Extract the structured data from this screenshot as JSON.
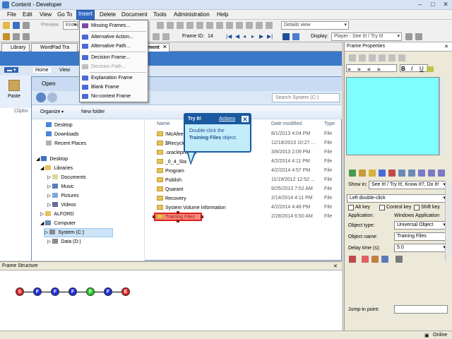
{
  "window": {
    "title": "Content - Developer"
  },
  "menu": [
    "File",
    "Edit",
    "View",
    "Go To",
    "Insert",
    "Delete",
    "Document",
    "Tools",
    "Administration",
    "Help"
  ],
  "toolbar": {
    "preview_label": "Preview",
    "know_combo": "Know",
    "view_combo": "Details view",
    "frame_id_label": "Frame ID:",
    "frame_id_value": "14",
    "display_label": "Display:",
    "display_combo": "Player - See It! / Try It!"
  },
  "doc_tabs": [
    {
      "label": "Library"
    },
    {
      "label": "WordPad Tra"
    },
    {
      "label": "ment"
    }
  ],
  "insert_menu": {
    "items": [
      {
        "label": "Missing Frames...",
        "disabled": false,
        "color": "#7a4aa8"
      },
      {
        "label": "Alternative Action...",
        "disabled": false,
        "color": "#4a6ad8"
      },
      {
        "label": "Alternative Path...",
        "disabled": false,
        "color": "#4a6ad8"
      },
      {
        "label": "Decision Frame...",
        "disabled": false,
        "color": "#4a6ad8"
      },
      {
        "label": "Decision Path...",
        "disabled": true,
        "color": "#a0a0a0"
      },
      {
        "label": "Explanation Frame",
        "disabled": false,
        "color": "#4a6ad8"
      },
      {
        "label": "Blank Frame",
        "disabled": false,
        "color": "#4a6ad8"
      },
      {
        "label": "No-context Frame",
        "disabled": false,
        "color": "#4a6ad8"
      }
    ]
  },
  "ribbon": {
    "tabs": [
      "Home",
      "View"
    ],
    "paste_label": "Paste",
    "clipboard_label": "Clipbo"
  },
  "explorer": {
    "title": "Open",
    "search_placeholder": "Search System (C:)",
    "organize_label": "Organize",
    "new_folder_label": "New folder",
    "nav": [
      {
        "label": "Desktop",
        "indent": 0
      },
      {
        "label": "Downloads",
        "indent": 0
      },
      {
        "label": "Recent Places",
        "indent": 0
      },
      {
        "label": "Desktop",
        "indent": 1
      },
      {
        "label": "Libraries",
        "indent": 2
      },
      {
        "label": "Documents",
        "indent": 3
      },
      {
        "label": "Music",
        "indent": 3
      },
      {
        "label": "Pictures",
        "indent": 3
      },
      {
        "label": "Videos",
        "indent": 3
      },
      {
        "label": "ALFORD",
        "indent": 2
      },
      {
        "label": "Computer",
        "indent": 2
      },
      {
        "label": "System (C:)",
        "indent": 3,
        "selected": true
      },
      {
        "label": "Data (D:)",
        "indent": 3
      }
    ],
    "columns": {
      "name": "Name",
      "date": "Date modified",
      "type": "Type"
    },
    "files": [
      {
        "name": "!McAfee.log",
        "date": "8/1/2013 4:04 PM",
        "type": "File"
      },
      {
        "name": "$Recycle.Bin",
        "date": "12/18/2013 10:27 ...",
        "type": "File"
      },
      {
        "name": ".oracleprinters",
        "date": "3/8/2013 2:09 PM",
        "type": "File"
      },
      {
        "name": "_0_4_Sta",
        "date": "4/2/2014 4:11 PM",
        "type": "File"
      },
      {
        "name": "Program",
        "date": "4/2/2014 4:57 PM",
        "type": "File"
      },
      {
        "name": "Publish",
        "date": "11/19/2012 12:52 ...",
        "type": "File"
      },
      {
        "name": "Quarant",
        "date": "9/25/2013 7:52 AM",
        "type": "File"
      },
      {
        "name": "Recovery",
        "date": "2/14/2014 4:11 PM",
        "type": "File"
      },
      {
        "name": "System Volume Information",
        "date": "4/2/2014 4:48 PM",
        "type": "File"
      },
      {
        "name": "Training Files",
        "date": "2/28/2014 6:50 AM",
        "type": "File"
      }
    ]
  },
  "bubble": {
    "title": "Try It!",
    "actions": "Actions",
    "text_prefix": "Double-click the",
    "text_bold": "Training Files",
    "text_suffix": "object."
  },
  "frame_props": {
    "title": "Frame Properties",
    "show_in_label": "Show in:",
    "show_in_value": "See It! / Try It!, Know It?, Do It!",
    "action_value": "Left double-click",
    "alt_key": "Alt key",
    "ctrl_key": "Control key",
    "shift_key": "Shift key",
    "application_label": "Application:",
    "application_value": "Windows Application",
    "object_type_label": "Object type:",
    "object_type_value": "Universal Object",
    "object_name_label": "Object name:",
    "object_name_value": "Training Files",
    "delay_label": "Delay time (s):",
    "delay_value": "5.0",
    "jump_label": "Jump-in point:"
  },
  "frame_structure": {
    "title": "Frame Structure",
    "nodes": [
      {
        "label": "S",
        "color": "#e02020"
      },
      {
        "label": "F",
        "color": "#1a2ee0"
      },
      {
        "label": "F",
        "color": "#1a2ee0"
      },
      {
        "label": "F",
        "color": "#1a2ee0"
      },
      {
        "label": "F",
        "color": "#22d022"
      },
      {
        "label": "F",
        "color": "#1a2ee0"
      },
      {
        "label": "E",
        "color": "#e02020"
      }
    ]
  },
  "status": {
    "online": "Online"
  }
}
